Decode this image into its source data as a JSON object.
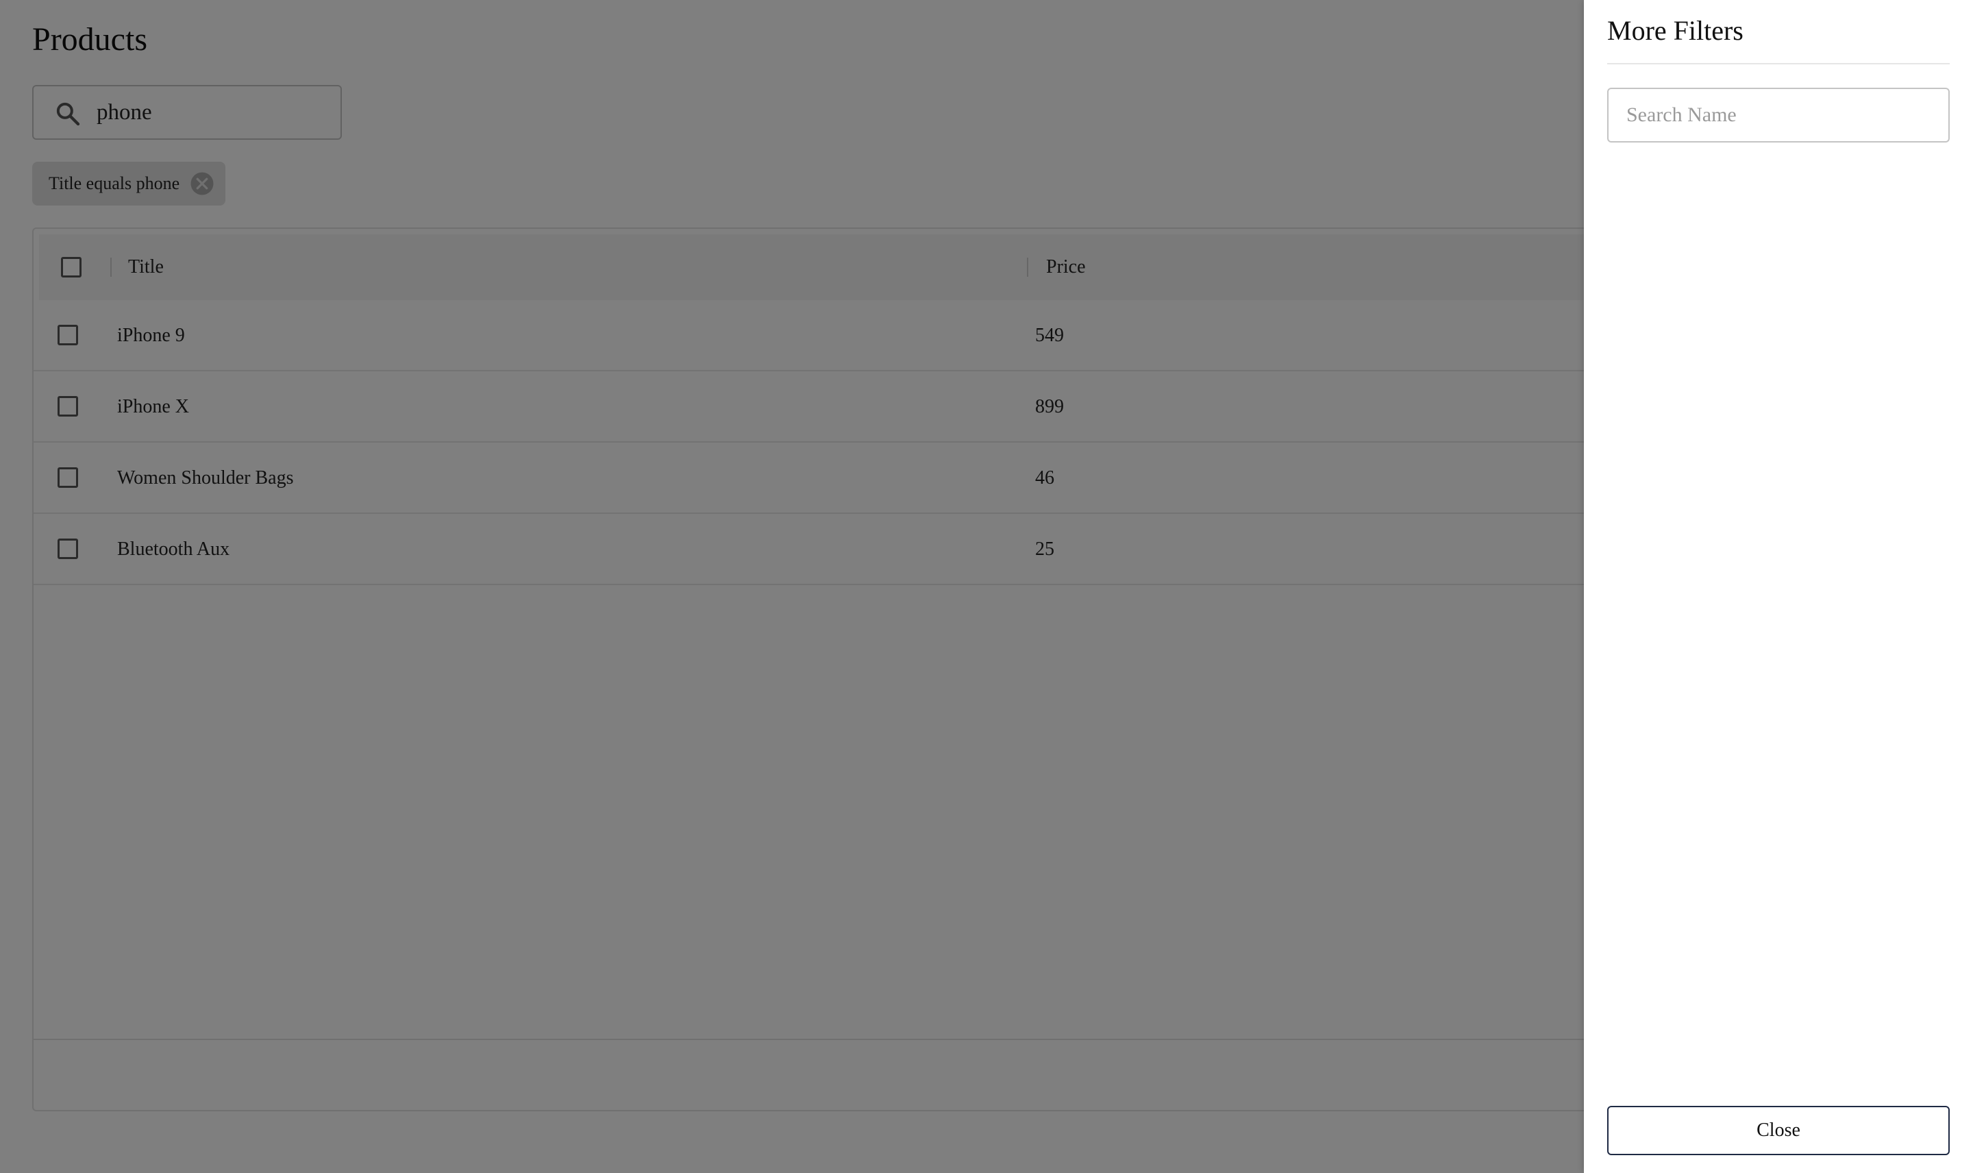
{
  "page": {
    "title": "Products"
  },
  "search": {
    "value": "phone",
    "icon": "search-icon"
  },
  "filter_chip": {
    "label": "Title equals phone",
    "remove_icon": "cancel-circle-icon"
  },
  "table": {
    "columns": [
      "Title",
      "Price"
    ],
    "rows": [
      {
        "title": "iPhone 9",
        "price": "549"
      },
      {
        "title": "iPhone X",
        "price": "899"
      },
      {
        "title": "Women Shoulder Bags",
        "price": "46"
      },
      {
        "title": "Bluetooth Aux",
        "price": "25"
      }
    ]
  },
  "drawer": {
    "title": "More Filters",
    "search_placeholder": "Search Name",
    "close_label": "Close"
  },
  "colors": {
    "backdrop": "rgba(0,0,0,0.5)",
    "header_bg": "#f4f4f4",
    "chip_bg": "#e0e0e0",
    "close_border": "#1f2a44"
  }
}
